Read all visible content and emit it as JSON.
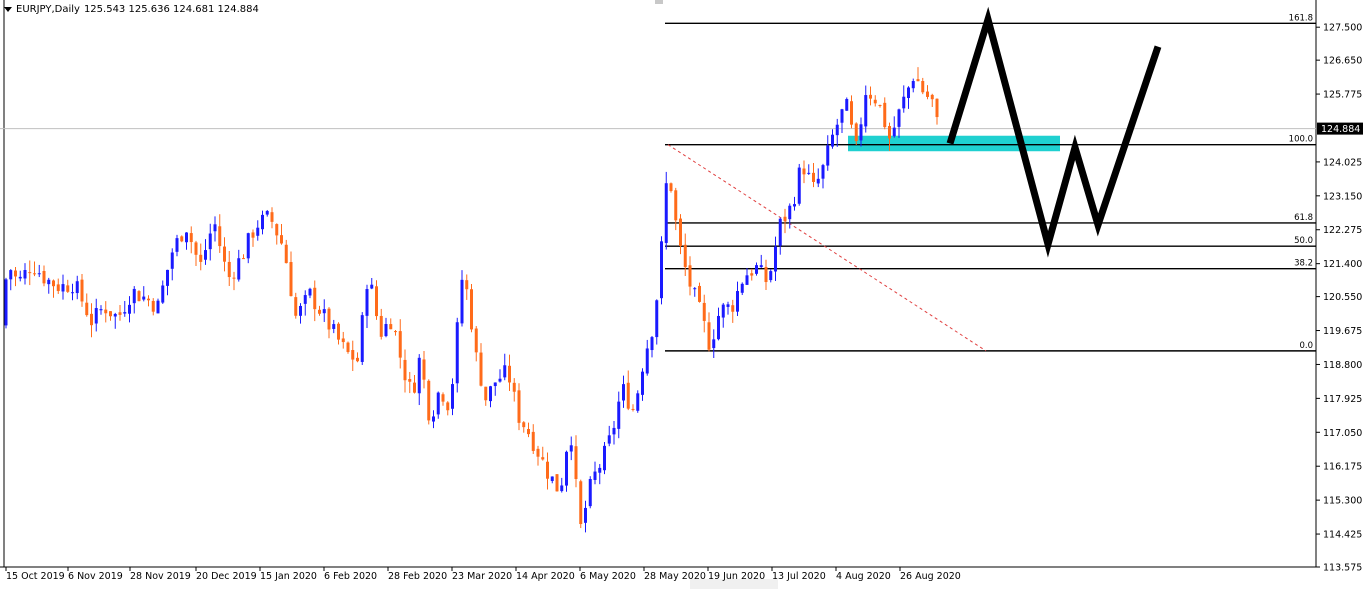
{
  "header": {
    "symbol": "EURJPY,Daily",
    "ohlc": "125.543 125.636 124.681 124.884"
  },
  "colors": {
    "bull": "#1a1aff",
    "bear": "#ff6b1a",
    "zone": "#1fd0d0",
    "fib_line": "#000000",
    "trend": "#e04040",
    "projection": "#000000"
  },
  "chart_data": {
    "type": "candlestick",
    "ylim": [
      113.575,
      128.15
    ],
    "y_ticks": [
      "127.500",
      "126.650",
      "125.775",
      "124.025",
      "123.150",
      "122.275",
      "121.400",
      "120.550",
      "119.675",
      "118.800",
      "117.925",
      "117.050",
      "116.175",
      "115.300",
      "114.425",
      "113.575"
    ],
    "current_price": "124.884",
    "x_ticks": [
      "15 Oct 2019",
      "6 Nov 2019",
      "28 Nov 2019",
      "20 Dec 2019",
      "15 Jan 2020",
      "6 Feb 2020",
      "28 Feb 2020",
      "23 Mar 2020",
      "14 Apr 2020",
      "6 May 2020",
      "28 May 2020",
      "19 Jun 2020",
      "13 Jul 2020",
      "4 Aug 2020",
      "26 Aug 2020"
    ],
    "path": [
      [
        0,
        119.8
      ],
      [
        8,
        121.4
      ],
      [
        18,
        120.9
      ],
      [
        32,
        121.4
      ],
      [
        46,
        121.0
      ],
      [
        60,
        120.8
      ],
      [
        74,
        120.9
      ],
      [
        92,
        119.9
      ],
      [
        104,
        120.3
      ],
      [
        118,
        120.0
      ],
      [
        132,
        120.7
      ],
      [
        146,
        120.5
      ],
      [
        158,
        120.3
      ],
      [
        172,
        121.7
      ],
      [
        186,
        122.4
      ],
      [
        200,
        121.3
      ],
      [
        214,
        122.5
      ],
      [
        228,
        121.0
      ],
      [
        242,
        121.6
      ],
      [
        256,
        122.4
      ],
      [
        270,
        122.6
      ],
      [
        284,
        121.8
      ],
      [
        296,
        120.0
      ],
      [
        310,
        120.6
      ],
      [
        320,
        120.2
      ],
      [
        334,
        119.6
      ],
      [
        346,
        119.1
      ],
      [
        358,
        118.9
      ],
      [
        368,
        121.2
      ],
      [
        380,
        119.6
      ],
      [
        392,
        120.0
      ],
      [
        402,
        118.8
      ],
      [
        412,
        118.0
      ],
      [
        420,
        119.0
      ],
      [
        430,
        117.4
      ],
      [
        440,
        118.2
      ],
      [
        450,
        117.7
      ],
      [
        462,
        121.0
      ],
      [
        468,
        120.6
      ],
      [
        476,
        119.0
      ],
      [
        486,
        117.9
      ],
      [
        496,
        118.4
      ],
      [
        508,
        118.6
      ],
      [
        518,
        117.5
      ],
      [
        530,
        117.0
      ],
      [
        546,
        116.1
      ],
      [
        560,
        115.5
      ],
      [
        570,
        117.3
      ],
      [
        580,
        114.5
      ],
      [
        592,
        115.8
      ],
      [
        602,
        116.3
      ],
      [
        612,
        117.0
      ],
      [
        622,
        118.2
      ],
      [
        634,
        117.6
      ],
      [
        644,
        119.0
      ],
      [
        654,
        119.9
      ],
      [
        660,
        121.3
      ],
      [
        668,
        124.0
      ],
      [
        678,
        122.0
      ],
      [
        688,
        121.0
      ],
      [
        698,
        120.3
      ],
      [
        710,
        119.3
      ],
      [
        720,
        120.2
      ],
      [
        732,
        120.3
      ],
      [
        744,
        121.1
      ],
      [
        756,
        121.3
      ],
      [
        768,
        120.9
      ],
      [
        780,
        122.4
      ],
      [
        792,
        122.9
      ],
      [
        802,
        124.0
      ],
      [
        814,
        123.3
      ],
      [
        824,
        123.9
      ],
      [
        834,
        124.8
      ],
      [
        846,
        125.5
      ],
      [
        856,
        124.3
      ],
      [
        866,
        125.9
      ],
      [
        878,
        125.6
      ],
      [
        890,
        124.6
      ],
      [
        902,
        125.5
      ],
      [
        914,
        126.3
      ],
      [
        924,
        125.8
      ],
      [
        932,
        125.6
      ],
      [
        938,
        124.9
      ]
    ],
    "fibonacci": [
      {
        "level": "161.8",
        "price": 127.6
      },
      {
        "level": "100.0",
        "price": 124.47
      },
      {
        "level": "61.8",
        "price": 122.45
      },
      {
        "level": "50.0",
        "price": 121.85
      },
      {
        "level": "38.2",
        "price": 121.27
      },
      {
        "level": "0.0",
        "price": 119.15
      }
    ],
    "trend_line": {
      "from": [
        668,
        124.47
      ],
      "to": [
        986,
        119.15
      ]
    },
    "zone": {
      "x": [
        848,
        1060
      ],
      "price": [
        124.3,
        124.7
      ]
    },
    "projection": [
      [
        950,
        124.5
      ],
      [
        988,
        127.7
      ],
      [
        1048,
        121.9
      ],
      [
        1075,
        124.4
      ],
      [
        1098,
        122.4
      ],
      [
        1158,
        127.0
      ]
    ]
  }
}
